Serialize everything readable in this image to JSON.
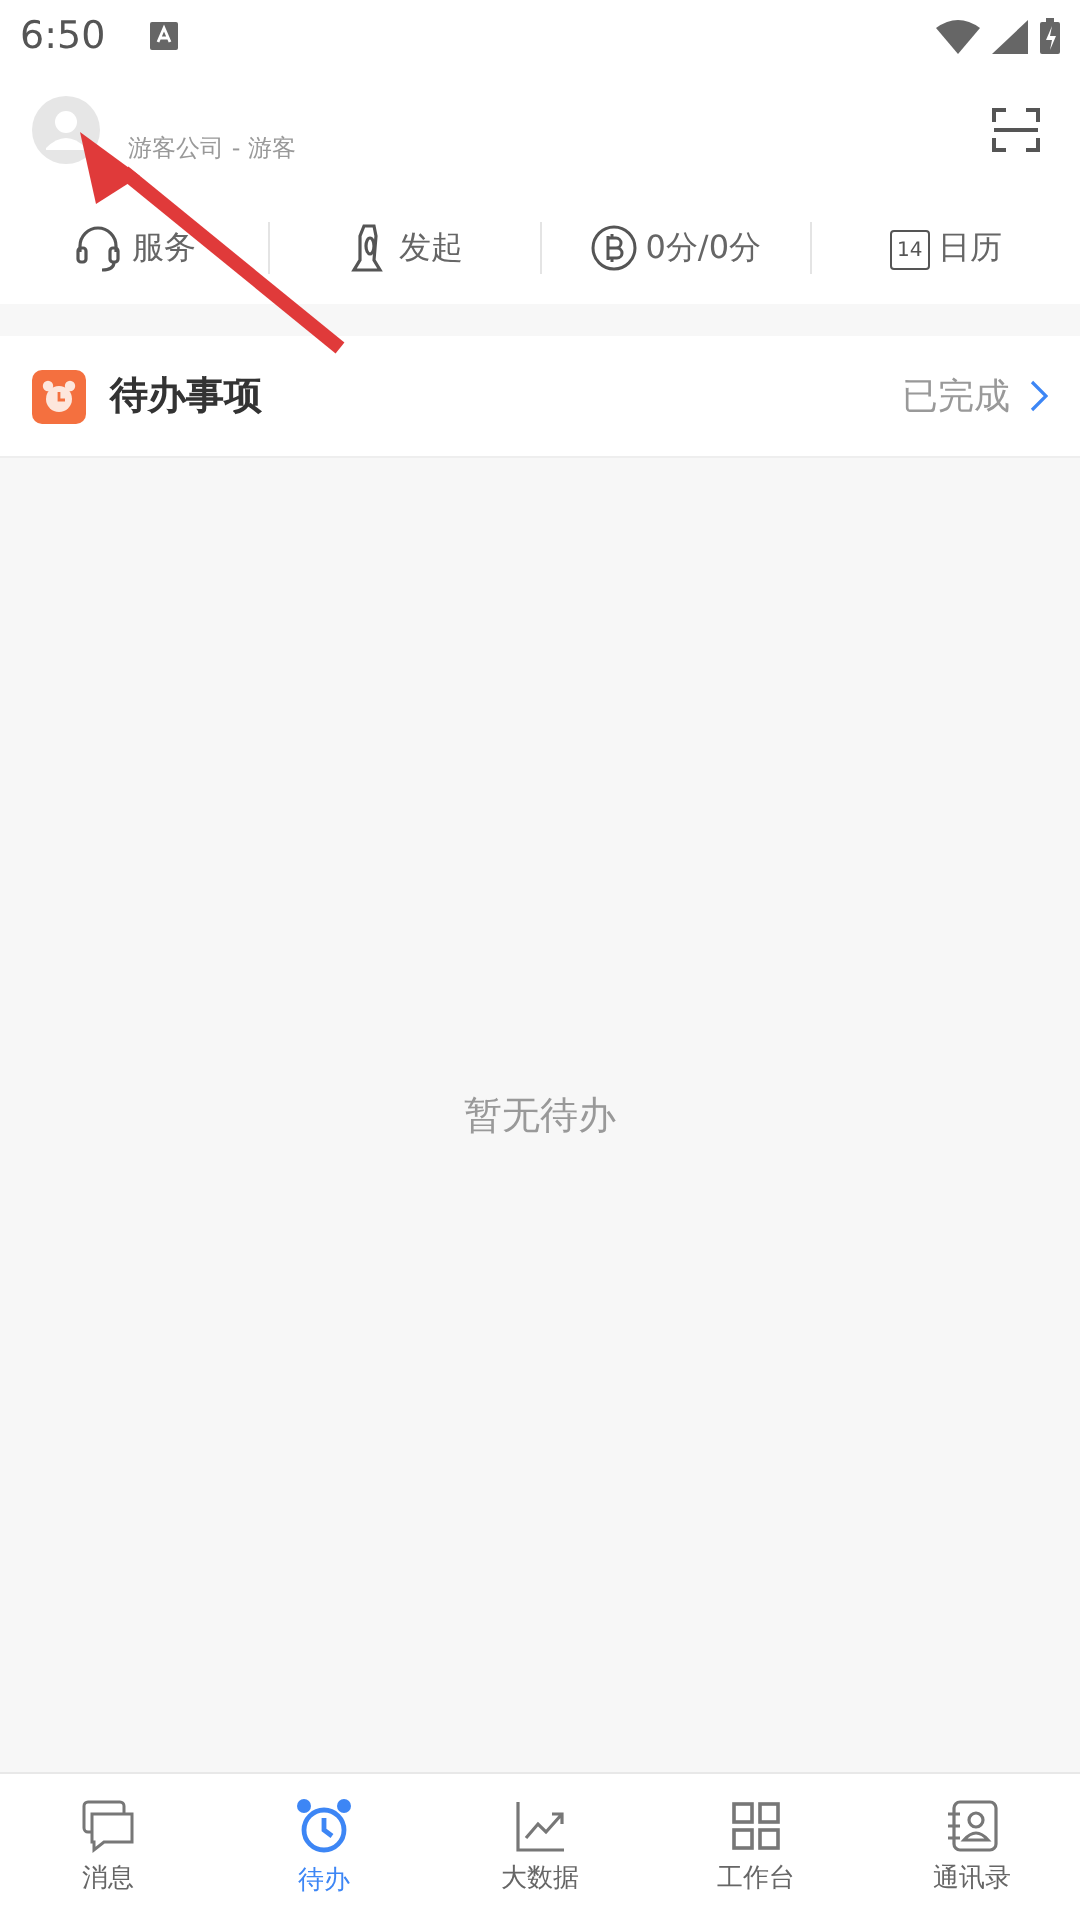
{
  "status_bar": {
    "time": "6:50"
  },
  "header": {
    "account": "游客公司 - 游客"
  },
  "quick_actions": [
    {
      "label": "服务"
    },
    {
      "label": "发起"
    },
    {
      "label": "0分/0分"
    },
    {
      "label": "日历",
      "icon_text": "14"
    }
  ],
  "todo": {
    "title": "待办事项",
    "completed_link": "已完成",
    "empty_text": "暂无待办"
  },
  "tabs": [
    {
      "label": "消息",
      "selected": false
    },
    {
      "label": "待办",
      "selected": true
    },
    {
      "label": "大数据",
      "selected": false
    },
    {
      "label": "工作台",
      "selected": false
    },
    {
      "label": "通讯录",
      "selected": false
    }
  ]
}
